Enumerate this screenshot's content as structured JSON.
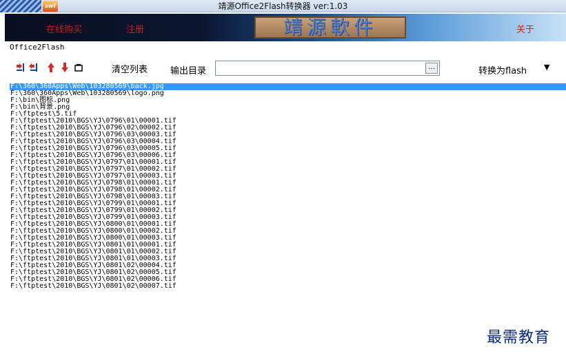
{
  "window": {
    "title": "靖源Office2Flash转换器 ver:1.03",
    "icon_text": "swf"
  },
  "banner": {
    "buy_label": "在线购买",
    "register_label": "注册",
    "logo_text": "靖源軟件",
    "about_label": "关于"
  },
  "menu": {
    "label": "Office2Flash"
  },
  "toolbar": {
    "icons": [
      "add-files-icon",
      "add-folder-icon",
      "move-up-icon",
      "move-down-icon",
      "remove-icon"
    ],
    "clear_label": "清空列表",
    "output_label": "输出目录",
    "output_value": "",
    "browse_label": "...",
    "convert_label": "转换为flash",
    "convert_caret": "▼"
  },
  "files": [
    "F:\\360\\360Apps\\Web\\103280569\\back.jpg",
    "F:\\360\\360Apps\\Web\\103280569\\logo.png",
    "F:\\bin\\图标.png",
    "F:\\bin\\背景.png",
    "F:\\ftptest\\5.tif",
    "F:\\ftptest\\2010\\BGS\\YJ\\0796\\01\\00001.tif",
    "F:\\ftptest\\2010\\BGS\\YJ\\0796\\02\\00002.tif",
    "F:\\ftptest\\2010\\BGS\\YJ\\0796\\03\\00003.tif",
    "F:\\ftptest\\2010\\BGS\\YJ\\0796\\03\\00004.tif",
    "F:\\ftptest\\2010\\BGS\\YJ\\0796\\03\\00005.tif",
    "F:\\ftptest\\2010\\BGS\\YJ\\0796\\03\\00006.tif",
    "F:\\ftptest\\2010\\BGS\\YJ\\0797\\01\\00001.tif",
    "F:\\ftptest\\2010\\BGS\\YJ\\0797\\01\\00002.tif",
    "F:\\ftptest\\2010\\BGS\\YJ\\0797\\01\\00003.tif",
    "F:\\ftptest\\2010\\BGS\\YJ\\0798\\01\\00001.tif",
    "F:\\ftptest\\2010\\BGS\\YJ\\0798\\01\\00002.tif",
    "F:\\ftptest\\2010\\BGS\\YJ\\0798\\01\\00003.tif",
    "F:\\ftptest\\2010\\BGS\\YJ\\0799\\01\\00001.tif",
    "F:\\ftptest\\2010\\BGS\\YJ\\0799\\01\\00002.tif",
    "F:\\ftptest\\2010\\BGS\\YJ\\0799\\01\\00003.tif",
    "F:\\ftptest\\2010\\BGS\\YJ\\0800\\01\\00001.tif",
    "F:\\ftptest\\2010\\BGS\\YJ\\0800\\01\\00002.tif",
    "F:\\ftptest\\2010\\BGS\\YJ\\0800\\01\\00003.tif",
    "F:\\ftptest\\2010\\BGS\\YJ\\0801\\01\\00001.tif",
    "F:\\ftptest\\2010\\BGS\\YJ\\0801\\01\\00002.tif",
    "F:\\ftptest\\2010\\BGS\\YJ\\0801\\01\\00003.tif",
    "F:\\ftptest\\2010\\BGS\\YJ\\0801\\02\\00004.tif",
    "F:\\ftptest\\2010\\BGS\\YJ\\0801\\02\\00005.tif",
    "F:\\ftptest\\2010\\BGS\\YJ\\0801\\02\\00006.tif",
    "F:\\ftptest\\2010\\BGS\\YJ\\0801\\02\\00007.tif"
  ],
  "selected_index": 0,
  "watermark": "最需教育",
  "colors": {
    "selection": "#3399ff",
    "banner_red": "#d41c1c"
  }
}
